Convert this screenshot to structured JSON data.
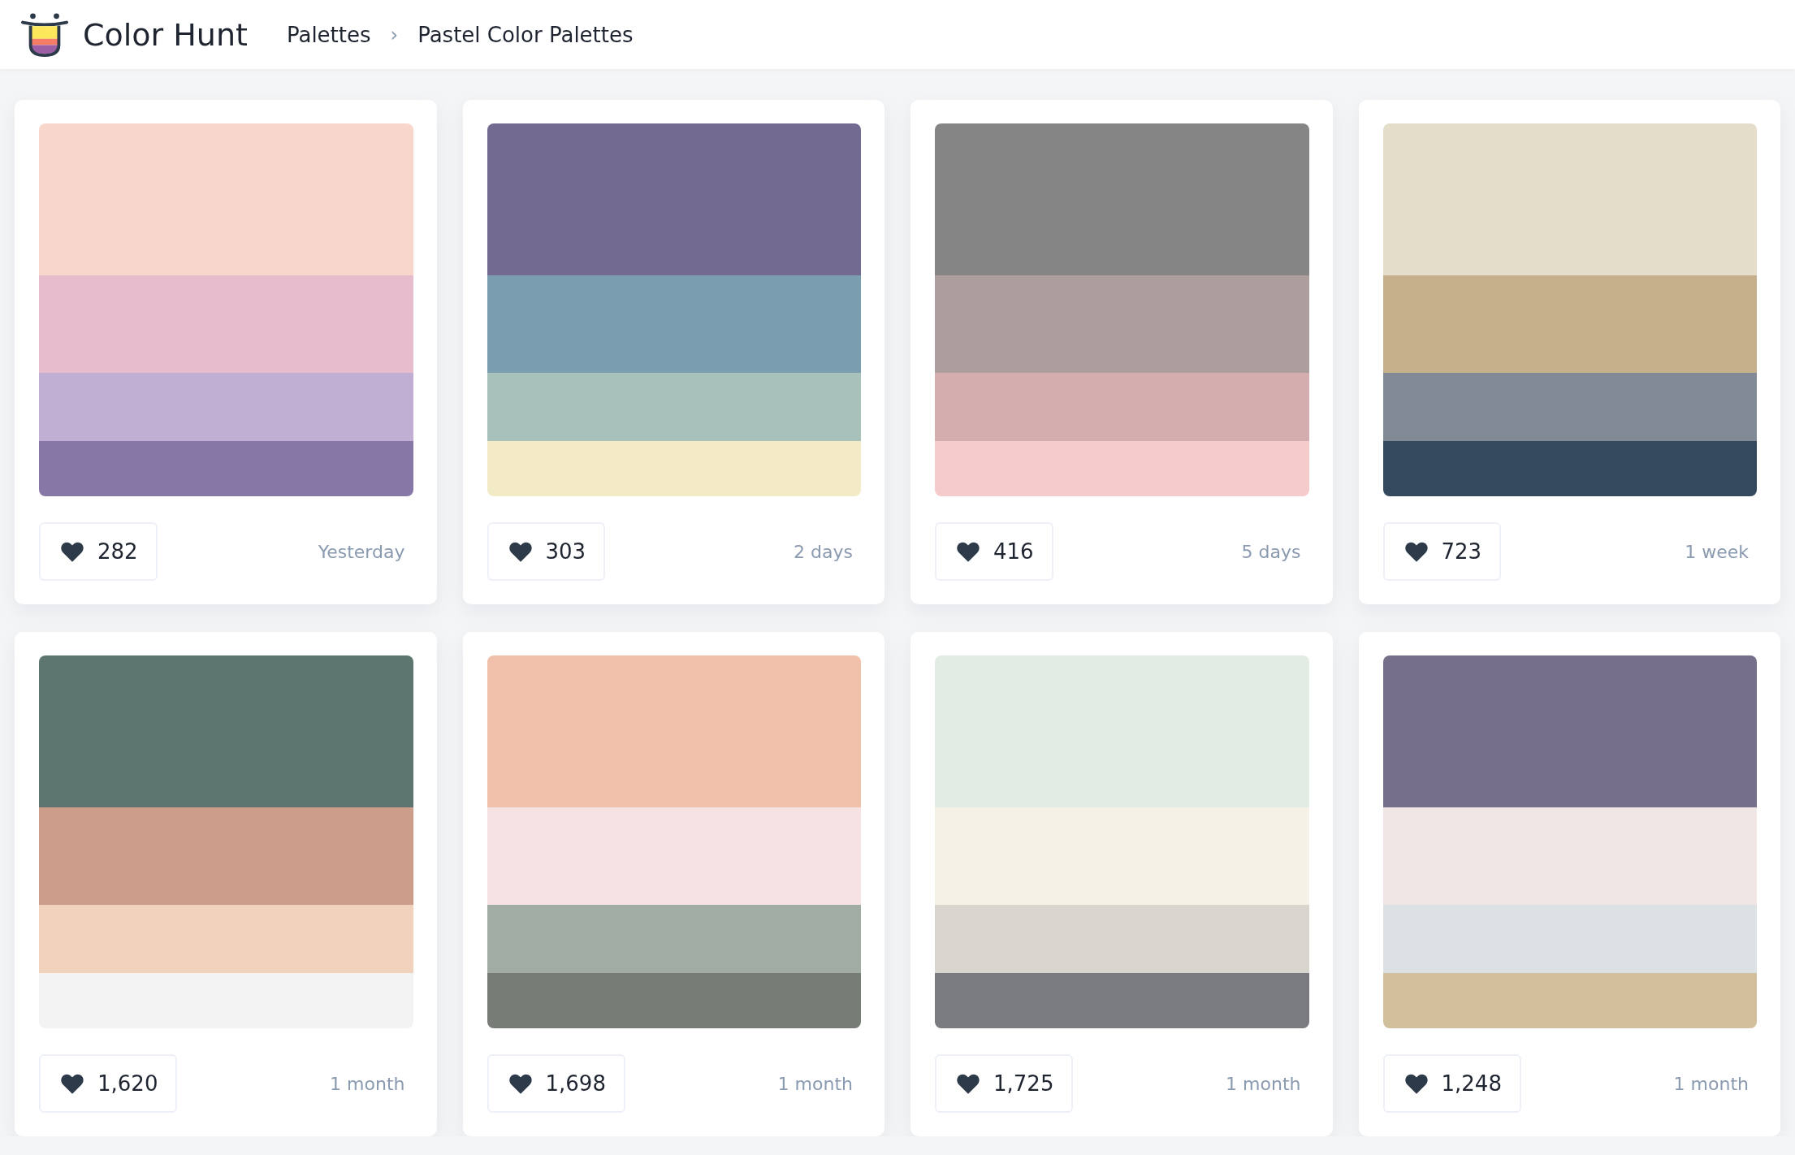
{
  "header": {
    "brand": "Color Hunt",
    "breadcrumbs": [
      "Palettes",
      "Pastel Color Palettes"
    ],
    "separator": "›"
  },
  "palettes": [
    {
      "swatches": [
        {
          "color": "#f9d6cc"
        },
        {
          "color": "#e7bdcd"
        },
        {
          "color": "#c1afd3"
        },
        {
          "color": "#8677a6"
        }
      ],
      "likes": "282",
      "date": "Yesterday"
    },
    {
      "swatches": [
        {
          "color": "#726a91"
        },
        {
          "color": "#7a9eaf"
        },
        {
          "color": "#a8c1ba"
        },
        {
          "color": "#f3eac6"
        }
      ],
      "likes": "303",
      "date": "2 days"
    },
    {
      "swatches": [
        {
          "color": "#858585"
        },
        {
          "color": "#ab9e9d"
        },
        {
          "color": "#d4aeae"
        },
        {
          "color": "#f5cbcb"
        }
      ],
      "likes": "416",
      "date": "5 days"
    },
    {
      "swatches": [
        {
          "color": "#e4ddca"
        },
        {
          "color": "#c6b08c"
        },
        {
          "color": "#818a95"
        },
        {
          "color": "#34495e"
        }
      ],
      "likes": "723",
      "date": "1 week"
    },
    {
      "swatches": [
        {
          "color": "#5d7670"
        },
        {
          "color": "#cc9d8b"
        },
        {
          "color": "#f1d2bd"
        },
        {
          "color": "#f3f3f3"
        }
      ],
      "likes": "1,620",
      "date": "1 month"
    },
    {
      "swatches": [
        {
          "color": "#f0c0aa"
        },
        {
          "color": "#f6e1e3"
        },
        {
          "color": "#a1ada3"
        },
        {
          "color": "#787c77"
        }
      ],
      "likes": "1,698",
      "date": "1 month"
    },
    {
      "swatches": [
        {
          "color": "#e2ece4"
        },
        {
          "color": "#f5f1e7"
        },
        {
          "color": "#d8d4ce"
        },
        {
          "color": "#7a7b7f"
        }
      ],
      "likes": "1,725",
      "date": "1 month"
    },
    {
      "swatches": [
        {
          "color": "#766f89"
        },
        {
          "color": "#f0e6e5"
        },
        {
          "color": "#dce1e4"
        },
        {
          "color": "#d2bf9c"
        }
      ],
      "likes": "1,248",
      "date": "1 month"
    }
  ]
}
